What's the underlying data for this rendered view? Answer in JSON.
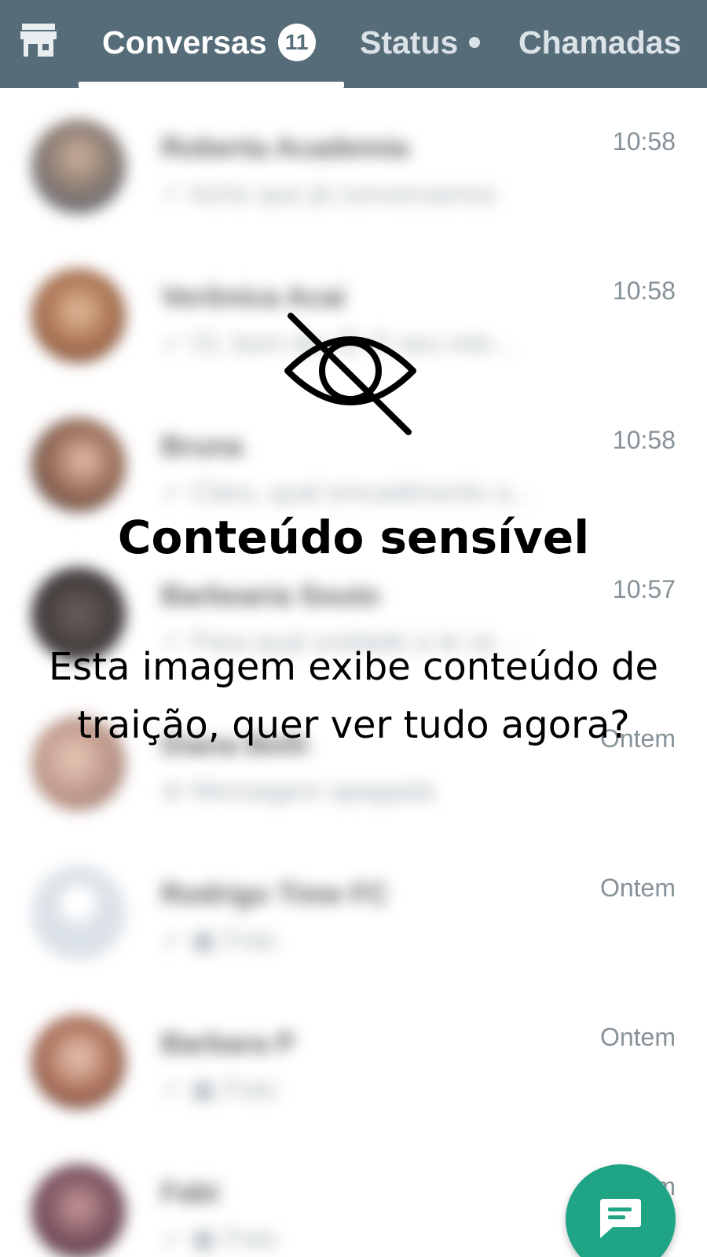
{
  "topbar": {
    "icon": "store-icon",
    "tabs": [
      {
        "label": "Conversas",
        "badge": "11"
      },
      {
        "label": "Status"
      },
      {
        "label": "Chamadas"
      }
    ]
  },
  "chats": [
    {
      "name": "Roberta Academia",
      "preview": "✓ Acho que já conversamos",
      "time": "10:58"
    },
    {
      "name": "Verônica Acai",
      "preview": "✓ Oi, bom dia 😊 O seu inte...",
      "time": "10:58"
    },
    {
      "name": "Bruna",
      "preview": "✓ Claro, qual emcadimento a...",
      "time": "10:58"
    },
    {
      "name": "Barbearia Souto",
      "preview": "✓ Para qual unidade a te ve ...",
      "time": "10:57"
    },
    {
      "name": "Diana Beth",
      "preview": "⊘ Mensagem apagada",
      "time": "Ontem"
    },
    {
      "name": "Rodrigo Time FC",
      "preview": "✓ ▣ Foto",
      "time": "Ontem"
    },
    {
      "name": "Barbara P",
      "preview": "✓ ▣ Foto",
      "time": "Ontem"
    },
    {
      "name": "Fabi",
      "preview": "✓ ▣ Foto",
      "time": "Ontem"
    }
  ],
  "overlay": {
    "icon": "eye-slash-icon",
    "title": "Conteúdo sensível",
    "message": "Esta imagem exibe conteúdo de traição, quer ver tudo agora?"
  },
  "fab": {
    "icon": "new-chat-icon"
  },
  "colors": {
    "topbar": "#3f5866",
    "fab": "#1fa585"
  }
}
